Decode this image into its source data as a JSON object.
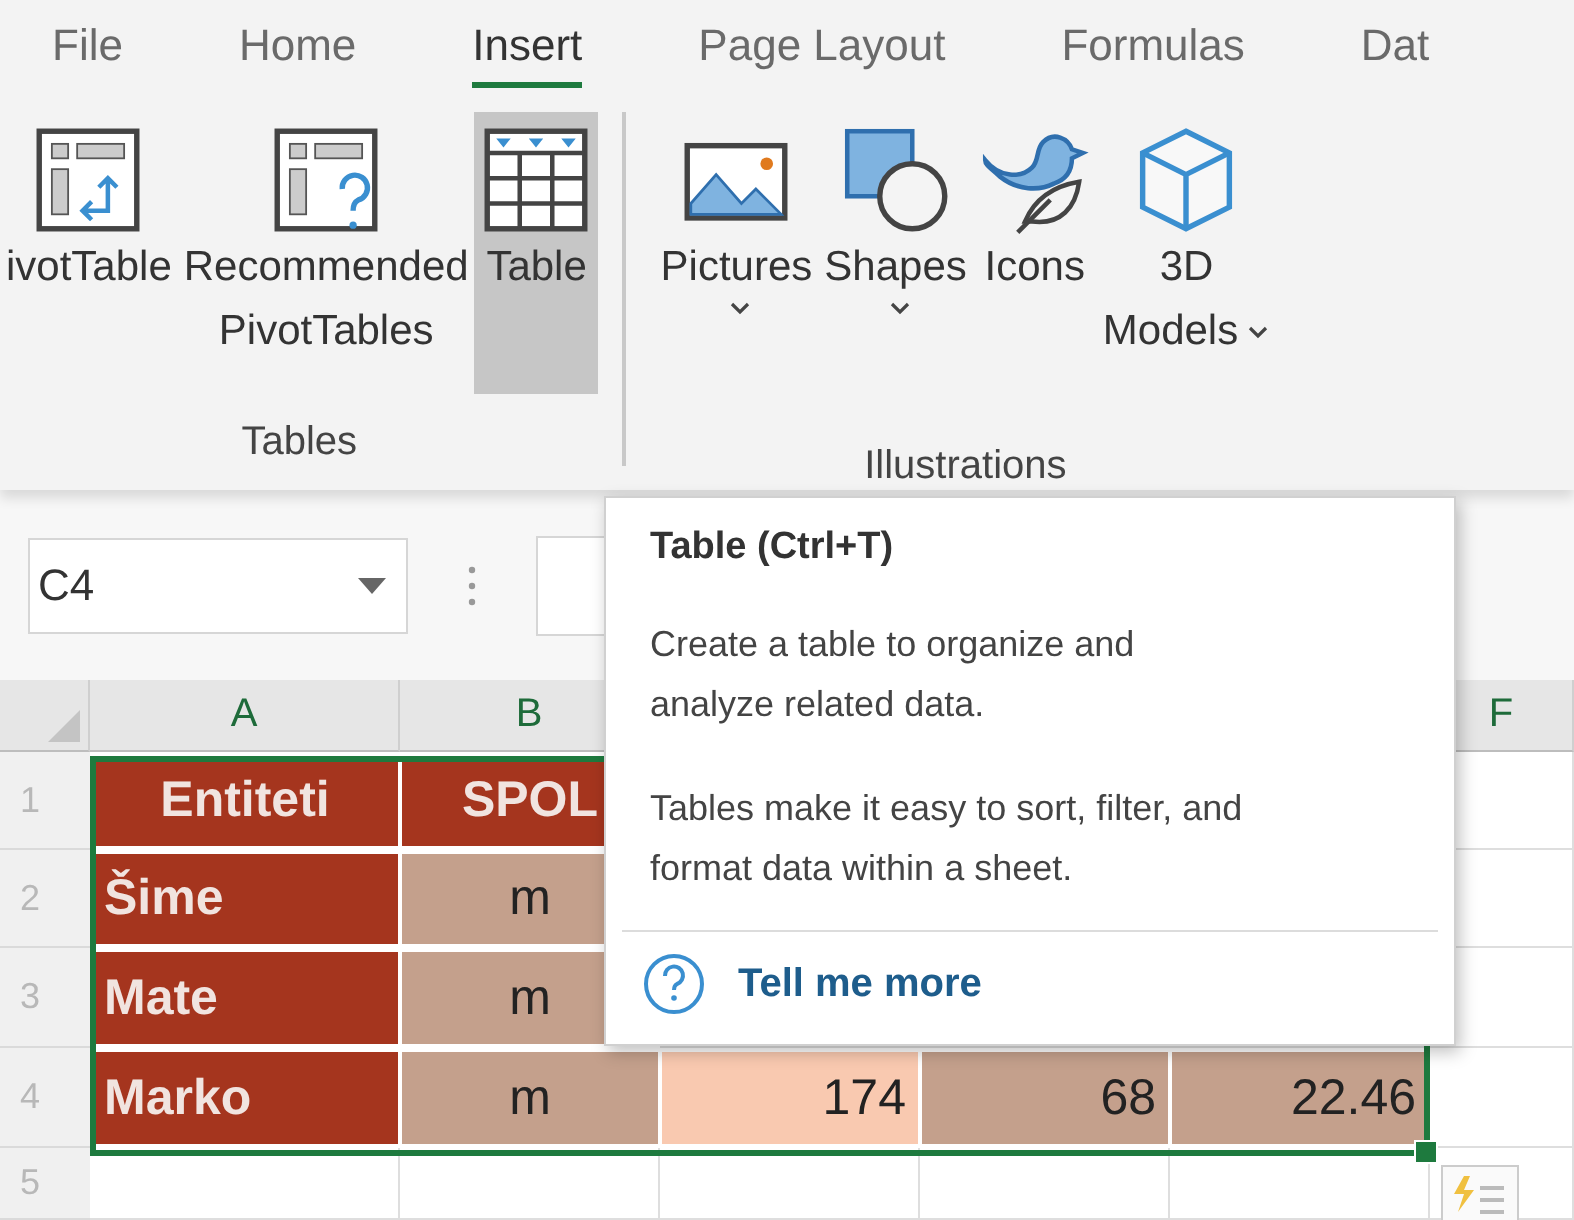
{
  "menu_tabs": [
    {
      "label": "File",
      "selected": false
    },
    {
      "label": "Home",
      "selected": false
    },
    {
      "label": "Insert",
      "selected": true
    },
    {
      "label": "Page Layout",
      "selected": false
    },
    {
      "label": "Formulas",
      "selected": false
    },
    {
      "label": "Dat",
      "selected": false
    }
  ],
  "ribbon_groups": [
    {
      "label": "Tables",
      "buttons": [
        {
          "kind": "pivot",
          "label": "ivotTable",
          "dropdown": false,
          "pressed": false
        },
        {
          "kind": "recommended",
          "label": "Recommended PivotTables",
          "dropdown": false,
          "pressed": false
        },
        {
          "kind": "table",
          "label": "Table",
          "dropdown": false,
          "pressed": true
        }
      ]
    },
    {
      "label": "Illustrations",
      "buttons": [
        {
          "kind": "pictures",
          "label": "Pictures",
          "dropdown": true,
          "pressed": false
        },
        {
          "kind": "shapes",
          "label": "Shapes",
          "dropdown": true,
          "pressed": false
        },
        {
          "kind": "icons",
          "label": "Icons",
          "dropdown": false,
          "pressed": false
        },
        {
          "kind": "models",
          "label": "3D Models",
          "dropdown": true,
          "pressed": false
        }
      ]
    }
  ],
  "name_box": {
    "value": "C4"
  },
  "column_headers": [
    "A",
    "B",
    "F"
  ],
  "row_numbers": [
    "1",
    "2",
    "3",
    "4",
    "5"
  ],
  "rows": [
    {
      "cells": [
        {
          "kind": "header",
          "text": "Entiteti"
        },
        {
          "kind": "header",
          "text": "SPOL"
        }
      ]
    },
    {
      "cells": [
        {
          "kind": "label",
          "text": "Šime"
        },
        {
          "kind": "value",
          "text": "m"
        }
      ]
    },
    {
      "cells": [
        {
          "kind": "label",
          "text": "Mate"
        },
        {
          "kind": "value",
          "text": "m"
        }
      ]
    },
    {
      "cells": [
        {
          "kind": "label",
          "text": "Marko"
        },
        {
          "kind": "value",
          "text": "m"
        },
        {
          "kind": "light",
          "text": "174"
        },
        {
          "kind": "number",
          "text": "68"
        },
        {
          "kind": "number",
          "text": "22.46"
        }
      ]
    }
  ],
  "tooltip": {
    "title": "Table (Ctrl+T)",
    "paragraphs": [
      "Create a table to organize and analyze related data.",
      "Tables make it easy to sort, filter, and format data within a sheet."
    ],
    "link": "Tell me more"
  }
}
